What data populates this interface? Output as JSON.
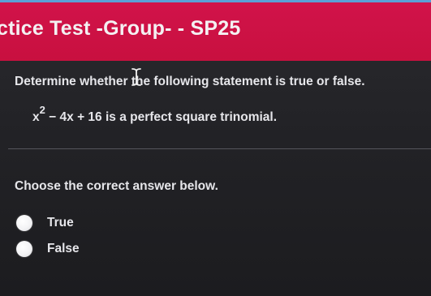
{
  "header": {
    "title": "ctice Test -Group- - SP25"
  },
  "question": {
    "instruction": "Determine whether the following statement is true or false.",
    "statement_base": "x",
    "statement_exponent": "2",
    "statement_rest": " − 4x + 16 is a perfect square trinomial."
  },
  "answer": {
    "prompt": "Choose the correct answer below.",
    "options": [
      {
        "label": "True"
      },
      {
        "label": "False"
      }
    ]
  },
  "colors": {
    "header": "#c8103f",
    "background": "#232327",
    "text": "#e6e6ea"
  },
  "icons": {
    "cursor": "text-cursor-icon",
    "radio": "radio-button-icon"
  }
}
